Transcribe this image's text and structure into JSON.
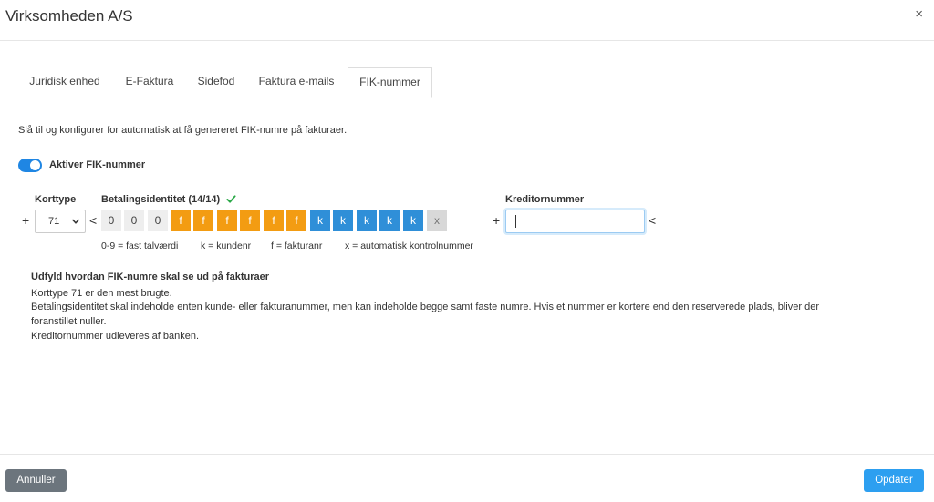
{
  "header": {
    "title": "Virksomheden A/S",
    "close_label": "×"
  },
  "tabs": [
    {
      "label": "Juridisk enhed",
      "active": false
    },
    {
      "label": "E-Faktura",
      "active": false
    },
    {
      "label": "Sidefod",
      "active": false
    },
    {
      "label": "Faktura e-mails",
      "active": false
    },
    {
      "label": "FIK-nummer",
      "active": true
    }
  ],
  "description": "Slå til og konfigurer for automatisk at få genereret FIK-numre på fakturaer.",
  "toggle": {
    "label": "Aktiver FIK-nummer",
    "on": true
  },
  "fik": {
    "korttype_label": "Korttype",
    "korttype_value": "71",
    "betaling_label": "Betalingsidentitet (14/14)",
    "kreditor_label": "Kreditornummer",
    "kreditor_value": "",
    "plus": "+",
    "lt": "<",
    "cells": [
      "0",
      "0",
      "0",
      "f",
      "f",
      "f",
      "f",
      "f",
      "f",
      "k",
      "k",
      "k",
      "k",
      "k",
      "x"
    ],
    "legend": {
      "fixed": "0-9 = fast talværdi",
      "k": "k = kundenr",
      "f": "f = fakturanr",
      "x": "x = automatisk kontrolnummer"
    }
  },
  "info": {
    "title": "Udfyld hvordan FIK-numre skal se ud på fakturaer",
    "line1": "Korttype 71 er den mest brugte.",
    "line2": "Betalingsidentitet skal indeholde enten kunde- eller fakturanummer, men kan indeholde begge samt faste numre. Hvis et nummer er kortere end den reserverede plads, bliver der",
    "line3": "foranstillet nuller.",
    "line4": "Kreditornummer udleveres af banken."
  },
  "footer": {
    "cancel_label": "Annuller",
    "update_label": "Opdater"
  },
  "colors": {
    "toggle": "#1f86e3",
    "cell_f": "#f39c12",
    "cell_k": "#2f8fd8",
    "primary_button": "#2d9ff0",
    "cancel_button": "#6c757d",
    "check": "#28a745"
  },
  "icons": {
    "check": "check-icon",
    "close": "close-icon",
    "select": "chevron-down-icon"
  }
}
